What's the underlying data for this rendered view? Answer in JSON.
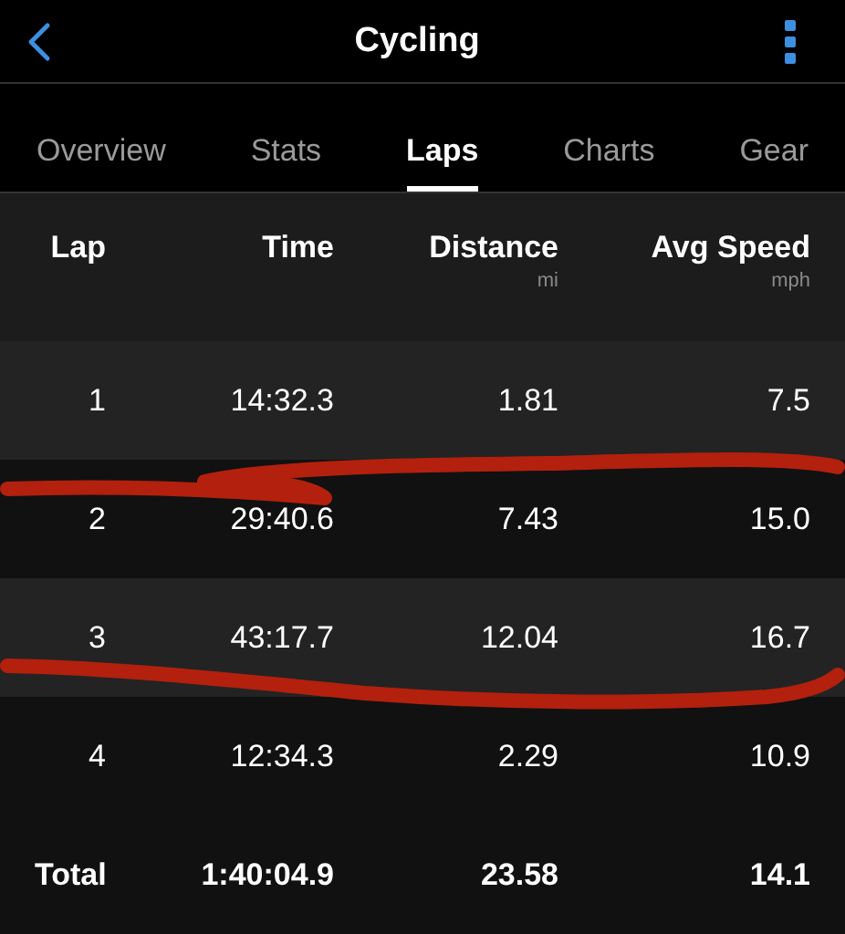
{
  "header": {
    "title": "Cycling"
  },
  "tabs": [
    {
      "label": "Overview",
      "selected": false
    },
    {
      "label": "Stats",
      "selected": false
    },
    {
      "label": "Laps",
      "selected": true
    },
    {
      "label": "Charts",
      "selected": false
    },
    {
      "label": "Gear",
      "selected": false
    }
  ],
  "table": {
    "columns": [
      {
        "label": "Lap"
      },
      {
        "label": "Time"
      },
      {
        "label": "Distance",
        "unit": "mi"
      },
      {
        "label": "Avg Speed",
        "unit": "mph"
      }
    ],
    "rows": [
      [
        "1",
        "14:32.3",
        "1.81",
        "7.5"
      ],
      [
        "2",
        "29:40.6",
        "7.43",
        "15.0"
      ],
      [
        "3",
        "43:17.7",
        "12.04",
        "16.7"
      ],
      [
        "4",
        "12:34.3",
        "2.29",
        "10.9"
      ]
    ],
    "total": [
      "Total",
      "1:40:04.9",
      "23.58",
      "14.1"
    ]
  },
  "markup": {
    "kind": "scribble"
  }
}
